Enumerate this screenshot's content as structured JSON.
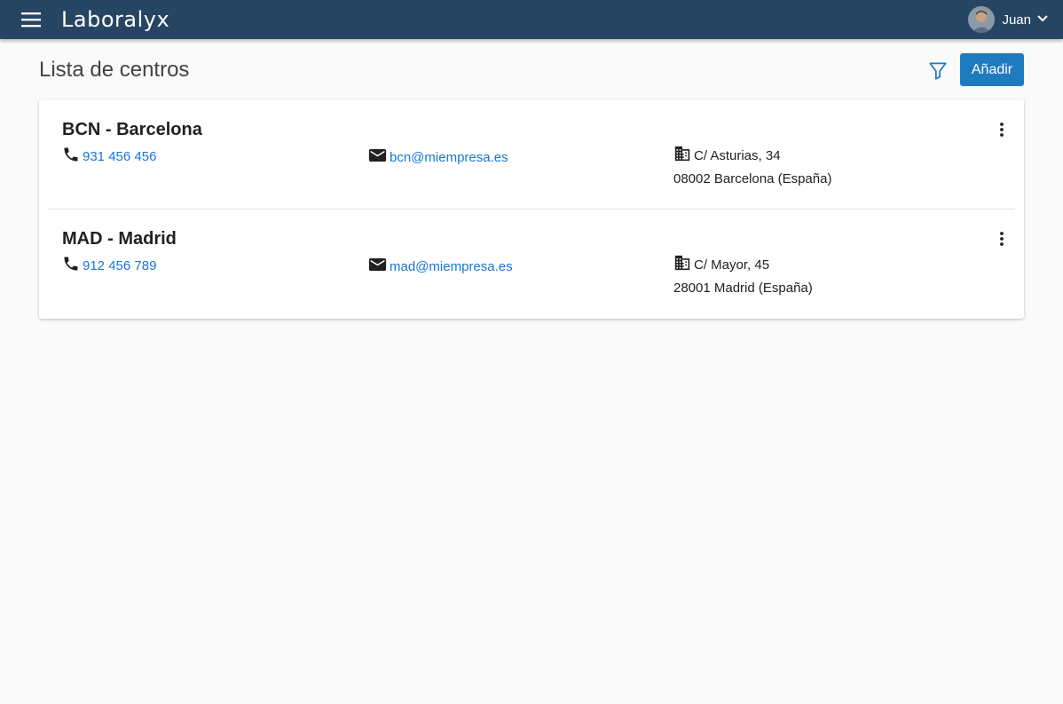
{
  "header": {
    "brand": "Laboralyx",
    "user_name": "Juan",
    "icons": {
      "menu": "menu-icon",
      "chevron": "chevron-down-icon"
    }
  },
  "page": {
    "title": "Lista de centros",
    "add_label": "Añadir"
  },
  "centers": [
    {
      "name": "BCN - Barcelona",
      "phone": "931 456 456",
      "email": "bcn@miempresa.es",
      "address_line1": "C/ Asturias, 34",
      "address_line2": "08002 Barcelona (España)"
    },
    {
      "name": "MAD - Madrid",
      "phone": "912 456 789",
      "email": "mad@miempresa.es",
      "address_line1": "C/ Mayor, 45",
      "address_line2": "28001 Madrid (España)"
    }
  ],
  "colors": {
    "header_bg": "#264563",
    "primary": "#1f7bbf",
    "link": "#1976d2",
    "page_bg": "#fafafa"
  }
}
